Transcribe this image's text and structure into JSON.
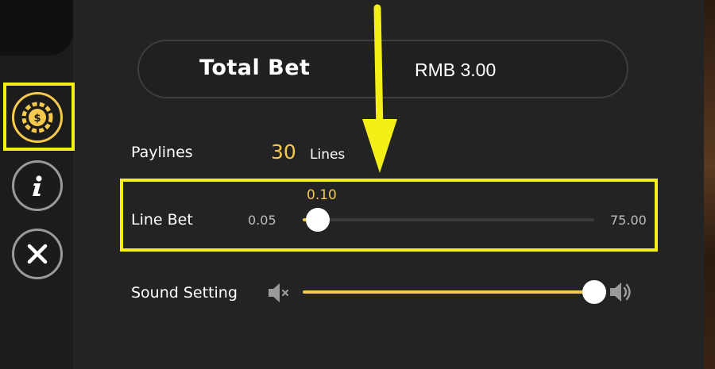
{
  "header": {
    "total_bet_label": "Total Bet",
    "total_bet_value": "RMB 3.00"
  },
  "paylines": {
    "label": "Paylines",
    "count": "30",
    "unit": "Lines"
  },
  "line_bet": {
    "label": "Line Bet",
    "current": "0.10",
    "min": "0.05",
    "max": "75.00",
    "slider_fraction": 0.03
  },
  "sound": {
    "label": "Sound Setting",
    "slider_fraction": 1.0
  },
  "sidebar": {
    "items": [
      {
        "name": "bet-settings",
        "icon": "coin-icon"
      },
      {
        "name": "info",
        "icon": "info-icon"
      },
      {
        "name": "close",
        "icon": "close-icon"
      }
    ]
  },
  "colors": {
    "accent_yellow": "#f4c94e",
    "highlight_yellow": "#f5ef18",
    "panel_bg": "#232323"
  }
}
